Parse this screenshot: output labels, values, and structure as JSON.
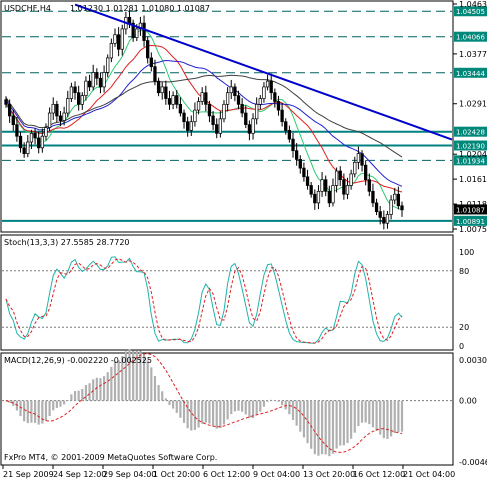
{
  "header": {
    "symbol": "USDCHF,H4",
    "ohlc": "1.01230 1.01281 1.01080 1.01087"
  },
  "colors": {
    "background": "#ffffff",
    "grid": "#7a7a7a",
    "candle": "#000000",
    "trendline": "#0000cc",
    "level_solid": "#008080",
    "level_dashed": "#006060",
    "tag_fill": "#00897b",
    "current_tag_fill": "#000000",
    "ma_fast": "#2ecc71",
    "ma_mid": "#e02020",
    "ma_slow": "#2020d0",
    "ma_long": "#404040",
    "stoch_main": "#20b2aa",
    "stoch_signal": "#e02020",
    "macd_hist": "#b0b0b0",
    "macd_signal": "#e02020"
  },
  "price_axis": {
    "ticks": [
      "1.04630",
      "1.03770",
      "1.02910",
      "1.02040",
      "1.01610",
      "1.01180",
      "1.00750"
    ],
    "top_value": "1.04630",
    "bottom_value": "1.00750"
  },
  "levels": [
    {
      "price": 1.04505,
      "label": "1.04505",
      "style": "dashed"
    },
    {
      "price": 1.04066,
      "label": "1.04066",
      "style": "dashed"
    },
    {
      "price": 1.03444,
      "label": "1.03444",
      "style": "dashed"
    },
    {
      "price": 1.02428,
      "label": "1.02428",
      "style": "solid"
    },
    {
      "price": 1.0219,
      "label": "1.02190",
      "style": "solid"
    },
    {
      "price": 1.01934,
      "label": "1.01934",
      "style": "dashed"
    },
    {
      "price": 1.00891,
      "label": "1.00891",
      "style": "solid"
    }
  ],
  "current_price": {
    "price": 1.01087,
    "label": "1.01087"
  },
  "stochastic": {
    "title": "Stoch(13,3,3) 27.5585 28.7720",
    "ticks": [
      "100",
      "80",
      "20",
      "0"
    ]
  },
  "macd": {
    "title": "MACD(12,26,9) -0.002220 -0.002525",
    "ticks": [
      "0.00307",
      "0.00",
      "-0.00464"
    ]
  },
  "time_axis": [
    "21 Sep 2009",
    "24 Sep 12:00",
    "29 Sep 04:00",
    "1 Oct 20:00",
    "6 Oct 12:00",
    "9 Oct 04:00",
    "13 Oct 20:00",
    "16 Oct 12:00",
    "21 Oct 04:00"
  ],
  "copyright": "FxPro MT4, © 2001-2009 MetaQuotes Software Corp.",
  "chart_data": {
    "type": "line",
    "title": "USDCHF,H4",
    "price_range": [
      1.0075,
      1.0463
    ],
    "close_series": [
      1.029,
      1.027,
      1.0255,
      1.0235,
      1.0215,
      1.0205,
      1.0225,
      1.024,
      1.0232,
      1.0215,
      1.0235,
      1.025,
      1.0275,
      1.029,
      1.027,
      1.0262,
      1.0275,
      1.03,
      1.032,
      1.031,
      1.029,
      1.0305,
      1.033,
      1.032,
      1.0345,
      1.0335,
      1.032,
      1.0345,
      1.037,
      1.0395,
      1.041,
      1.0385,
      1.042,
      1.044,
      1.043,
      1.0405,
      1.042,
      1.043,
      1.04,
      1.037,
      1.0355,
      1.033,
      1.031,
      1.032,
      1.03,
      1.029,
      1.0305,
      1.029,
      1.0275,
      1.026,
      1.0245,
      1.026,
      1.028,
      1.0295,
      1.031,
      1.029,
      1.027,
      1.0255,
      1.024,
      1.0265,
      1.029,
      1.031,
      1.032,
      1.0305,
      1.029,
      1.0275,
      1.0255,
      1.024,
      1.0265,
      1.029,
      1.03,
      1.032,
      1.033,
      1.031,
      1.0295,
      1.028,
      1.026,
      1.0245,
      1.023,
      1.021,
      1.0195,
      1.018,
      1.0165,
      1.015,
      1.0135,
      1.012,
      1.014,
      1.016,
      1.014,
      1.012,
      1.015,
      1.0175,
      1.016,
      1.0135,
      1.015,
      1.017,
      1.019,
      1.0205,
      1.0185,
      1.016,
      1.014,
      1.012,
      1.0105,
      1.0095,
      1.0085,
      1.01,
      1.0125,
      1.0135,
      1.0115,
      1.0108
    ],
    "trendline": {
      "from_index": 19,
      "from_price": 1.0462,
      "to_index": 108,
      "to_price": 1.025
    },
    "stochastic_range": [
      0,
      100
    ],
    "macd_range": [
      -0.00464,
      0.00307
    ]
  }
}
